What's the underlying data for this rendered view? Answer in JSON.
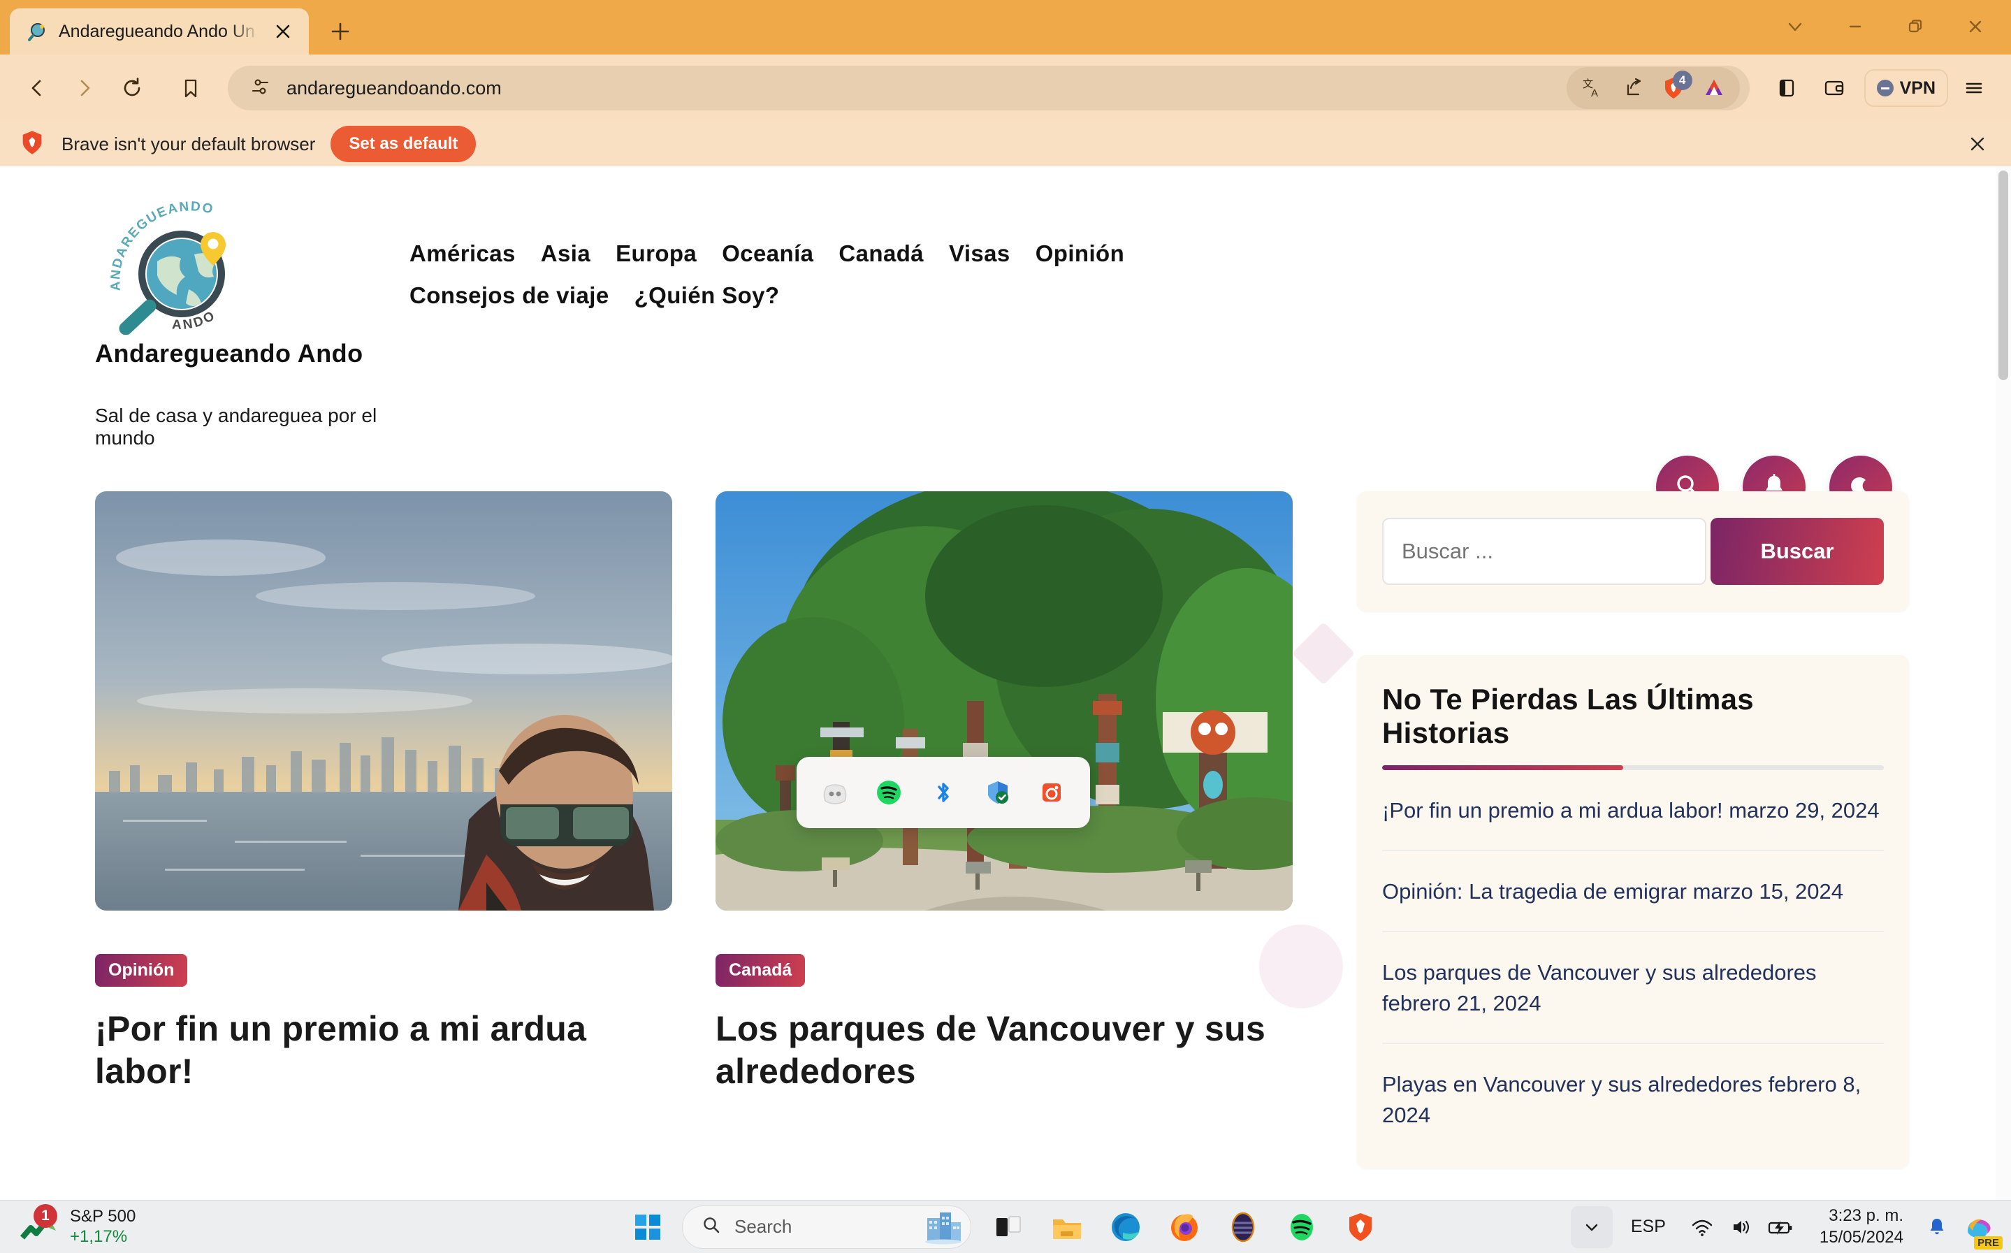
{
  "browser": {
    "name": "Brave",
    "tab": {
      "title": "Andaregueando Ando Un blog d",
      "favicon": "globe-magnifier-icon"
    },
    "newtab_label": "+",
    "window_controls": {
      "tab_search": "tab-search-icon",
      "minimize": "minimize-icon",
      "restore": "restore-icon",
      "close": "close-icon"
    },
    "toolbar": {
      "back": "back-arrow-icon",
      "forward": "forward-arrow-icon",
      "reload": "reload-icon",
      "bookmark": "bookmark-icon",
      "url": "andaregueandoando.com",
      "site_settings": "tune-icon",
      "translate": "translate-icon",
      "share": "share-icon",
      "shields": "brave-shields-icon",
      "shields_count": "4",
      "rewards": "bat-triangle-icon",
      "sidebar": "sidebar-panel-icon",
      "wallet": "wallet-icon",
      "vpn_label": "VPN",
      "menu": "hamburger-menu-icon"
    },
    "default_bar": {
      "message": "Brave isn't your default browser",
      "button": "Set as default",
      "close": "close-icon"
    }
  },
  "site": {
    "brand_title": "Andaregueando Ando",
    "tagline": "Sal de casa y andareguea por el mundo",
    "logo_text_top": "ANDAREGUEANDO",
    "logo_text_bottom": "ANDO",
    "nav_row1": [
      {
        "label": "Américas"
      },
      {
        "label": "Asia"
      },
      {
        "label": "Europa"
      },
      {
        "label": "Oceanía"
      },
      {
        "label": "Canadá"
      },
      {
        "label": "Visas"
      },
      {
        "label": "Opinión"
      }
    ],
    "nav_row2": [
      {
        "label": "Consejos de viaje"
      },
      {
        "label": "¿Quién Soy?"
      }
    ],
    "actions": [
      {
        "name": "search-button",
        "icon": "search-icon"
      },
      {
        "name": "notifications-button",
        "icon": "bell-icon"
      },
      {
        "name": "dark-mode-button",
        "icon": "moon-icon"
      }
    ],
    "accent_gradient_start": "#7b2566",
    "accent_gradient_end": "#cf3f4e",
    "cards": [
      {
        "category": "Opinión",
        "title": "¡Por fin un premio a mi ardua labor!",
        "image": "selfie-man-sunglasses-city-skyline-sunset"
      },
      {
        "category": "Canadá",
        "title": "Los parques de Vancouver y sus alrededores",
        "image": "totem-poles-stanley-park-trees"
      }
    ],
    "sidebar": {
      "search": {
        "placeholder": "Buscar ...",
        "button": "Buscar"
      },
      "stories_widget": {
        "title": "No Te Pierdas Las Últimas Historias",
        "stories": [
          {
            "title": "¡Por fin un premio a mi ardua labor!",
            "date": "marzo 29, 2024"
          },
          {
            "title": "Opinión: La tragedia de emigrar",
            "date": "marzo 15, 2024"
          },
          {
            "title": "Los parques de Vancouver y sus alrededores",
            "date": "febrero 21, 2024"
          },
          {
            "title": "Playas en Vancouver y sus alrededores",
            "date": "febrero 8, 2024"
          }
        ]
      }
    }
  },
  "tray_flyout": {
    "icons": [
      {
        "name": "discord-icon"
      },
      {
        "name": "spotify-icon"
      },
      {
        "name": "bluetooth-icon"
      },
      {
        "name": "windows-security-icon"
      },
      {
        "name": "camera-app-icon"
      }
    ]
  },
  "taskbar": {
    "widget": {
      "name": "S&P 500",
      "value": "+1,17%",
      "badge": "1",
      "icon": "stocks-up-icon"
    },
    "start": "windows-start-icon",
    "search": {
      "placeholder": "Search",
      "icon": "search-icon",
      "thumbnail": "city-buildings-thumbnail"
    },
    "apps": [
      {
        "name": "task-view-icon"
      },
      {
        "name": "file-explorer-icon"
      },
      {
        "name": "microsoft-edge-icon",
        "running": true
      },
      {
        "name": "firefox-icon",
        "running": true
      },
      {
        "name": "thunderbird-icon",
        "running": true
      },
      {
        "name": "spotify-icon",
        "running": true
      },
      {
        "name": "brave-browser-icon",
        "running": true
      }
    ],
    "tray": {
      "expand": "chevron-up-icon",
      "language": "ESP",
      "wifi": "wifi-icon",
      "volume": "volume-icon",
      "battery": "battery-charging-icon",
      "time": "3:23 p. m.",
      "date": "15/05/2024",
      "notifications": "bell-icon",
      "copilot": "copilot-icon",
      "copilot_badge": "PRE"
    }
  }
}
